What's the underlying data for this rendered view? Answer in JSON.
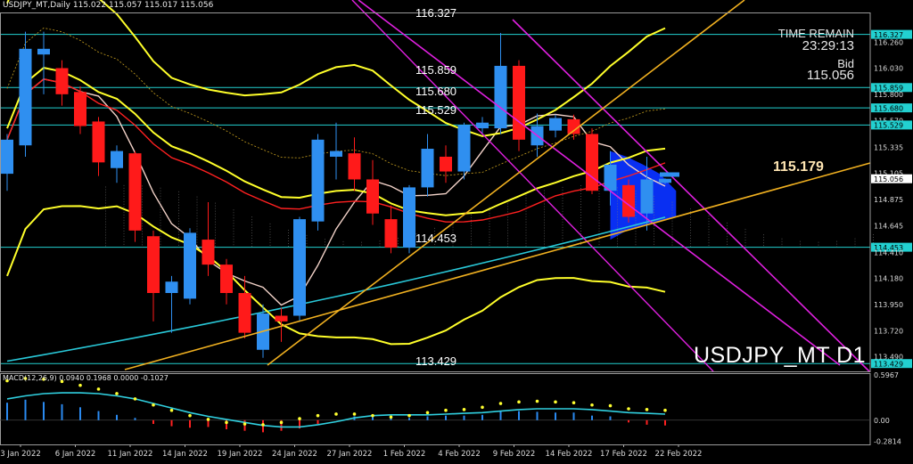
{
  "header": {
    "main": "USDJPY_MT,Daily  115.022 115.057 115.017 115.056",
    "macd": "MACD(12,26,9) 0.0940 0.1968 0.0000 -0.1027"
  },
  "info": {
    "time_remain_label": "TIME REMAIN",
    "time_remain": "23:29:13",
    "bid_label": "Bid",
    "bid": "115.056"
  },
  "symbol_label": "USDJPY_MT D1",
  "level_labels": [
    {
      "text": "116.327",
      "price": 116.327
    },
    {
      "text": "115.859",
      "price": 115.859
    },
    {
      "text": "115.680",
      "price": 115.68
    },
    {
      "text": "115.529",
      "price": 115.529
    },
    {
      "text": "114.453",
      "price": 114.453
    },
    {
      "text": "113.429",
      "price": 113.429
    }
  ],
  "projection_label": "115.179",
  "colors": {
    "up_candle": "#2f8ff0",
    "down_candle": "#ff1a1a",
    "bollinger": "#ffff2a",
    "ma_red": "#ff2020",
    "ma_white": "#f2d2c8",
    "ma_cyan": "#29c8d8",
    "channel": "#e020e0",
    "trend": "#f0b020",
    "hline": "#22d0d0",
    "macd_bar": "#2a8af0",
    "macd_bar_neg": "#ff2020",
    "macd_signal": "#30d0e0",
    "macd_dots": "#ffff30",
    "cloud_blue": "#0a32ff"
  },
  "chart_data": [
    {
      "type": "candlestick",
      "title": "USDJPY_MT,Daily",
      "y_axis_ticks": [
        116.26,
        116.03,
        115.8,
        115.57,
        115.335,
        115.105,
        114.875,
        114.645,
        114.41,
        114.18,
        113.95,
        113.72,
        113.49
      ],
      "y_axis_labels": [
        {
          "text": "116.327",
          "price": 116.327,
          "highlight": true
        },
        {
          "text": "116.260",
          "price": 116.26
        },
        {
          "text": "116.030",
          "price": 116.03
        },
        {
          "text": "115.859",
          "price": 115.859,
          "highlight": true
        },
        {
          "text": "115.800",
          "price": 115.8
        },
        {
          "text": "115.680",
          "price": 115.68,
          "highlight": true
        },
        {
          "text": "115.570",
          "price": 115.57
        },
        {
          "text": "115.529",
          "price": 115.529,
          "highlight": true
        },
        {
          "text": "115.335",
          "price": 115.335
        },
        {
          "text": "115.105",
          "price": 115.105
        },
        {
          "text": "115.056",
          "price": 115.056,
          "bid": true
        },
        {
          "text": "114.875",
          "price": 114.875
        },
        {
          "text": "114.645",
          "price": 114.645
        },
        {
          "text": "114.453",
          "price": 114.453,
          "highlight": true
        },
        {
          "text": "114.410",
          "price": 114.41
        },
        {
          "text": "114.180",
          "price": 114.18
        },
        {
          "text": "113.950",
          "price": 113.95
        },
        {
          "text": "113.720",
          "price": 113.72
        },
        {
          "text": "113.490",
          "price": 113.49
        },
        {
          "text": "113.429",
          "price": 113.429,
          "highlight": true
        }
      ],
      "x_axis_labels": [
        {
          "text": "3 Jan 2022",
          "index": 0
        },
        {
          "text": "6 Jan 2022",
          "index": 3
        },
        {
          "text": "11 Jan 2022",
          "index": 6
        },
        {
          "text": "14 Jan 2022",
          "index": 9
        },
        {
          "text": "19 Jan 2022",
          "index": 12
        },
        {
          "text": "24 Jan 2022",
          "index": 15
        },
        {
          "text": "27 Jan 2022",
          "index": 18
        },
        {
          "text": "1 Feb 2022",
          "index": 21
        },
        {
          "text": "4 Feb 2022",
          "index": 24
        },
        {
          "text": "9 Feb 2022",
          "index": 27
        },
        {
          "text": "14 Feb 2022",
          "index": 30
        },
        {
          "text": "17 Feb 2022",
          "index": 33
        },
        {
          "text": "22 Feb 2022",
          "index": 36
        }
      ],
      "ylim": [
        113.36,
        116.52
      ],
      "horizontal_levels": [
        116.327,
        115.859,
        115.68,
        115.529,
        114.453,
        113.429
      ],
      "candles": [
        {
          "o": 115.1,
          "h": 115.45,
          "l": 114.95,
          "c": 115.4
        },
        {
          "o": 115.35,
          "h": 116.35,
          "l": 115.25,
          "c": 116.2
        },
        {
          "o": 116.15,
          "h": 116.35,
          "l": 115.8,
          "c": 116.2
        },
        {
          "o": 116.03,
          "h": 116.1,
          "l": 115.7,
          "c": 115.8
        },
        {
          "o": 115.82,
          "h": 115.87,
          "l": 115.45,
          "c": 115.52
        },
        {
          "o": 115.56,
          "h": 115.6,
          "l": 115.08,
          "c": 115.2
        },
        {
          "o": 115.15,
          "h": 115.35,
          "l": 115.02,
          "c": 115.3
        },
        {
          "o": 115.28,
          "h": 115.3,
          "l": 114.5,
          "c": 114.6
        },
        {
          "o": 114.55,
          "h": 114.6,
          "l": 113.8,
          "c": 114.05
        },
        {
          "o": 114.05,
          "h": 114.2,
          "l": 113.7,
          "c": 114.15
        },
        {
          "o": 114.0,
          "h": 114.62,
          "l": 113.95,
          "c": 114.58
        },
        {
          "o": 114.52,
          "h": 114.85,
          "l": 114.2,
          "c": 114.3
        },
        {
          "o": 114.3,
          "h": 114.35,
          "l": 113.95,
          "c": 114.05
        },
        {
          "o": 114.05,
          "h": 114.2,
          "l": 113.65,
          "c": 113.7
        },
        {
          "o": 113.55,
          "h": 113.95,
          "l": 113.48,
          "c": 113.87
        },
        {
          "o": 113.85,
          "h": 113.92,
          "l": 113.62,
          "c": 113.8
        },
        {
          "o": 113.85,
          "h": 114.72,
          "l": 113.8,
          "c": 114.7
        },
        {
          "o": 114.68,
          "h": 115.45,
          "l": 114.6,
          "c": 115.4
        },
        {
          "o": 115.25,
          "h": 115.55,
          "l": 115.05,
          "c": 115.3
        },
        {
          "o": 115.28,
          "h": 115.42,
          "l": 114.95,
          "c": 115.05
        },
        {
          "o": 115.05,
          "h": 115.22,
          "l": 114.65,
          "c": 114.75
        },
        {
          "o": 114.7,
          "h": 114.82,
          "l": 114.4,
          "c": 114.45
        },
        {
          "o": 114.45,
          "h": 115.0,
          "l": 114.4,
          "c": 114.98
        },
        {
          "o": 114.98,
          "h": 115.45,
          "l": 114.9,
          "c": 115.32
        },
        {
          "o": 115.25,
          "h": 115.35,
          "l": 115.02,
          "c": 115.12
        },
        {
          "o": 115.12,
          "h": 115.55,
          "l": 115.05,
          "c": 115.53
        },
        {
          "o": 115.5,
          "h": 115.6,
          "l": 115.45,
          "c": 115.55
        },
        {
          "o": 115.5,
          "h": 116.34,
          "l": 115.45,
          "c": 116.05
        },
        {
          "o": 116.05,
          "h": 116.1,
          "l": 115.3,
          "c": 115.4
        },
        {
          "o": 115.35,
          "h": 115.63,
          "l": 115.25,
          "c": 115.52
        },
        {
          "o": 115.48,
          "h": 115.62,
          "l": 115.42,
          "c": 115.59
        },
        {
          "o": 115.58,
          "h": 115.62,
          "l": 115.4,
          "c": 115.45
        },
        {
          "o": 115.45,
          "h": 115.5,
          "l": 114.92,
          "c": 114.95
        },
        {
          "o": 114.95,
          "h": 115.3,
          "l": 114.82,
          "c": 115.18
        },
        {
          "o": 115.0,
          "h": 115.05,
          "l": 114.67,
          "c": 114.72
        },
        {
          "o": 114.75,
          "h": 115.25,
          "l": 114.6,
          "c": 115.05
        },
        {
          "o": 115.02,
          "h": 115.06,
          "l": 115.01,
          "c": 115.056
        }
      ]
    },
    {
      "type": "bar",
      "title": "MACD(12,26,9)",
      "ylim": [
        -0.32,
        0.62
      ],
      "y_axis_labels": [
        {
          "text": "0.5967",
          "value": 0.5967
        },
        {
          "text": "0.00",
          "value": 0.0
        },
        {
          "text": "-0.2814",
          "value": -0.2814
        }
      ],
      "histogram": [
        0.23,
        0.27,
        0.24,
        0.21,
        0.17,
        0.12,
        0.07,
        0.03,
        -0.05,
        -0.08,
        -0.1,
        -0.09,
        -0.12,
        -0.14,
        -0.16,
        -0.14,
        -0.11,
        -0.05,
        0.0,
        0.05,
        0.04,
        0.03,
        0.03,
        0.05,
        0.06,
        0.06,
        0.07,
        0.12,
        0.12,
        0.11,
        0.1,
        0.1,
        0.06,
        0.05,
        -0.03,
        -0.06,
        -0.07
      ],
      "signal": [
        0.28,
        0.32,
        0.35,
        0.36,
        0.36,
        0.35,
        0.32,
        0.28,
        0.22,
        0.16,
        0.1,
        0.05,
        0.01,
        -0.03,
        -0.07,
        -0.09,
        -0.09,
        -0.06,
        -0.02,
        0.03,
        0.06,
        0.07,
        0.07,
        0.07,
        0.08,
        0.09,
        0.1,
        0.12,
        0.14,
        0.15,
        0.15,
        0.15,
        0.14,
        0.12,
        0.1,
        0.09,
        0.08
      ],
      "dots": [
        0.52,
        0.55,
        0.54,
        0.51,
        0.46,
        0.41,
        0.35,
        0.28,
        0.2,
        0.13,
        0.06,
        0.01,
        -0.03,
        -0.05,
        -0.06,
        -0.03,
        0.02,
        0.06,
        0.08,
        0.08,
        0.06,
        0.04,
        0.06,
        0.1,
        0.13,
        0.14,
        0.17,
        0.22,
        0.24,
        0.25,
        0.24,
        0.23,
        0.2,
        0.19,
        0.15,
        0.14,
        0.13
      ]
    }
  ]
}
